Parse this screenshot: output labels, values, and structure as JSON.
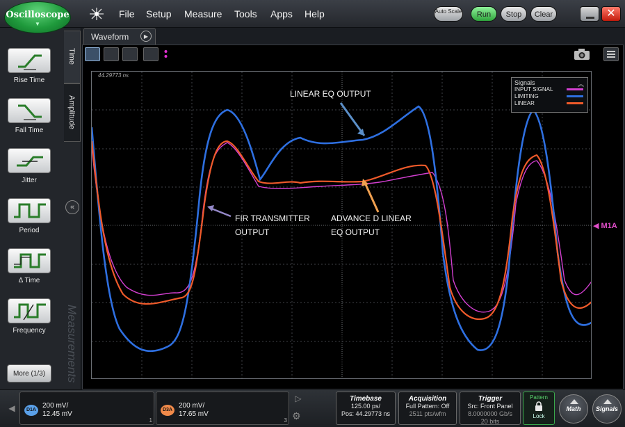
{
  "app": {
    "logo_text": "Oscilloscope",
    "logo_arrow": "▼",
    "menu": [
      "File",
      "Setup",
      "Measure",
      "Tools",
      "Apps",
      "Help"
    ]
  },
  "controls": {
    "auto_scale": "Auto Scale",
    "run": "Run",
    "stop": "Stop",
    "clear": "Clear",
    "close": "✕",
    "run_color": "#3fbf4f"
  },
  "left_panel": {
    "tabs": [
      "Time",
      "Amplitude"
    ],
    "measurements": [
      {
        "label": "Rise Time",
        "icon": "rise-time-icon"
      },
      {
        "label": "Fall Time",
        "icon": "fall-time-icon"
      },
      {
        "label": "Jitter",
        "icon": "jitter-icon"
      },
      {
        "label": "Period",
        "icon": "period-icon"
      },
      {
        "label": "Δ Time",
        "icon": "delta-time-icon"
      },
      {
        "label": "Frequency",
        "icon": "frequency-icon"
      }
    ],
    "collapse": "«",
    "watermark": "Measurements",
    "more": "More (1/3)"
  },
  "waveform": {
    "tab_label": "Waveform",
    "play": "▶",
    "time_readout": "44.29773 ns",
    "marker": "◀ M1A"
  },
  "legend": {
    "title": "Signals",
    "up": "︽",
    "items": [
      {
        "name": "INPUT SIGNAL",
        "color": "#d23fd0"
      },
      {
        "name": "LIMITING",
        "color": "#2e6fe0"
      },
      {
        "name": "LINEAR",
        "color": "#ef5a2a"
      }
    ]
  },
  "annotations": {
    "linear_eq": "LINEAR EQ OUTPUT",
    "fir_1": "FIR TRANSMITTER",
    "fir_2": "OUTPUT",
    "adv_1": "ADVANCE D LINEAR",
    "adv_2": "EQ OUTPUT"
  },
  "channels": [
    {
      "badge": "D1A",
      "scale": "200 mV/",
      "offset": "12.45 mV",
      "color": "#5aa0e8",
      "corner": "1"
    },
    {
      "badge": "D3A",
      "scale": "200 mV/",
      "offset": "17.65 mV",
      "color": "#f08a4a",
      "corner": "3"
    }
  ],
  "timebase": {
    "title": "Timebase",
    "line1": "125.00 ps/",
    "line2": "Pos: 44.29773 ns"
  },
  "acquisition": {
    "title": "Acquisition",
    "line1": "Full Pattern: Off",
    "line2": "2511 pts/wfm"
  },
  "trigger": {
    "title": "Trigger",
    "line1": "Src: Front Panel",
    "line2": "8.0000000 Gb/s",
    "line3": "20 bits"
  },
  "pattern": {
    "label": "Pattern",
    "lock": "Lock"
  },
  "buttons": {
    "math": "Math",
    "signals": "Signals"
  }
}
